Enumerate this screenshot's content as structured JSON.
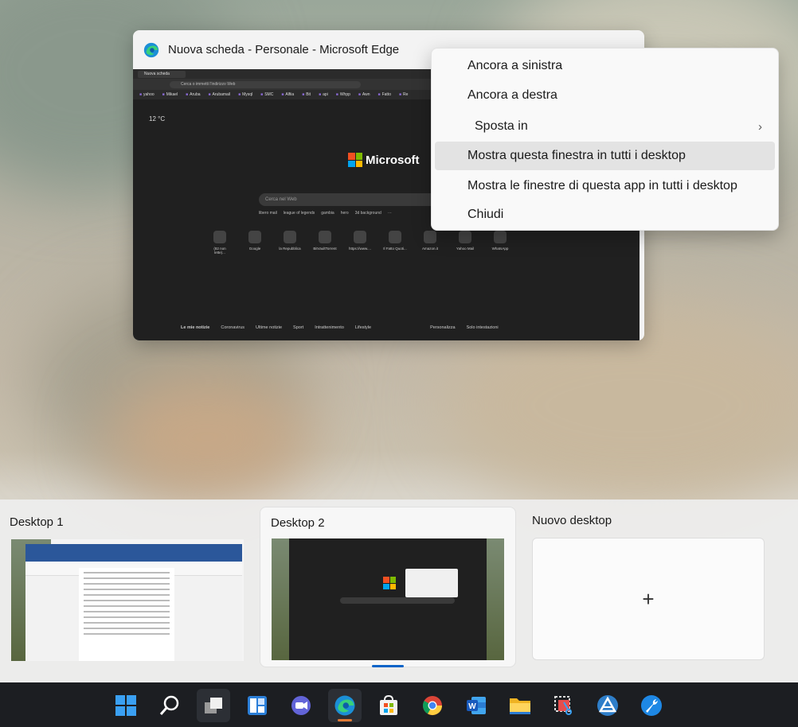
{
  "window": {
    "title": "Nuova scheda - Personale - Microsoft Edge",
    "thumb": {
      "tab": "Nuova scheda",
      "url_placeholder": "Cerca o immetti l'indirizzo Web",
      "favorites": [
        "yahoo",
        "Mikael",
        "Aruba",
        "Arubamail",
        "Mysql",
        "SMC",
        "Alfiia",
        "Bit",
        "api",
        "Whpp",
        "Awn",
        "Fatto",
        "Re"
      ],
      "weather": "12 °C",
      "brand": "Microsoft",
      "search_placeholder": "Cerca nel Web",
      "quick_links": [
        "libero mail",
        "league of legends",
        "gambia",
        "hero",
        "3d background",
        "···"
      ],
      "tiles": [
        "(82 non lette)...",
        "Google",
        "la Repubblica",
        "BitVaultTorrent",
        "https://www....",
        "Il Fatto Quoti...",
        "Amazon.it",
        "Yahoo Mail",
        "WhatsApp"
      ],
      "news": [
        "Le mie notizie",
        "Coronavirus",
        "Ultime notizie",
        "Sport",
        "Intrattenimento",
        "Lifestyle"
      ],
      "personalize": "Personalizza",
      "layout": "Solo intestazioni"
    }
  },
  "context_menu": {
    "items": [
      {
        "label": "Ancora a sinistra"
      },
      {
        "label": "Ancora a destra"
      },
      {
        "label": "Sposta in",
        "submenu": true
      },
      {
        "label": "Mostra questa finestra in tutti i desktop",
        "highlighted": true
      },
      {
        "label": "Mostra le finestre di questa app in tutti i desktop"
      },
      {
        "label": "Chiudi"
      }
    ],
    "chevron": "›"
  },
  "desktops": {
    "items": [
      {
        "label": "Desktop 1",
        "active": false
      },
      {
        "label": "Desktop 2",
        "active": true
      }
    ],
    "new_label": "Nuovo desktop",
    "new_symbol": "+"
  },
  "taskbar": {
    "accent": "#e07a36",
    "apps": [
      "start-icon",
      "search-icon",
      "task-view-icon",
      "widgets-icon",
      "chat-icon",
      "edge-icon",
      "store-icon",
      "chrome-icon",
      "word-icon",
      "file-explorer-icon",
      "snipping-tool-icon",
      "app-triangle-icon",
      "app-wrench-icon"
    ]
  }
}
